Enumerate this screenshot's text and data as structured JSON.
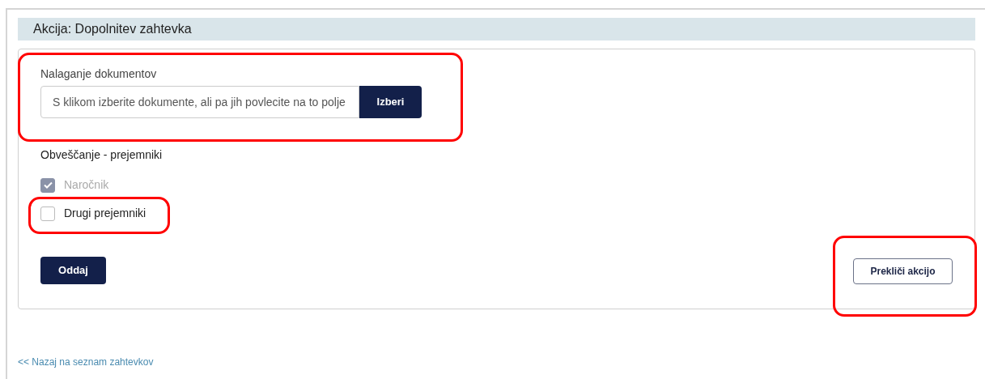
{
  "header": {
    "title": "Akcija: Dopolnitev zahtevka"
  },
  "upload": {
    "label": "Nalaganje dokumentov",
    "placeholder": "S klikom izberite dokumente, ali pa jih povlecite na to polje",
    "button": "Izberi",
    "highlighted": true
  },
  "recipients": {
    "title": "Obveščanje - prejemniki",
    "items": [
      {
        "label": "Naročnik",
        "checked": true,
        "disabled": true,
        "highlighted": false
      },
      {
        "label": "Drugi prejemniki",
        "checked": false,
        "disabled": false,
        "highlighted": true
      }
    ]
  },
  "submit": {
    "label": "Oddaj"
  },
  "cancel": {
    "label": "Prekliči akcijo",
    "highlighted": true
  },
  "back_link": {
    "label": "<< Nazaj na seznam zahtevkov"
  }
}
